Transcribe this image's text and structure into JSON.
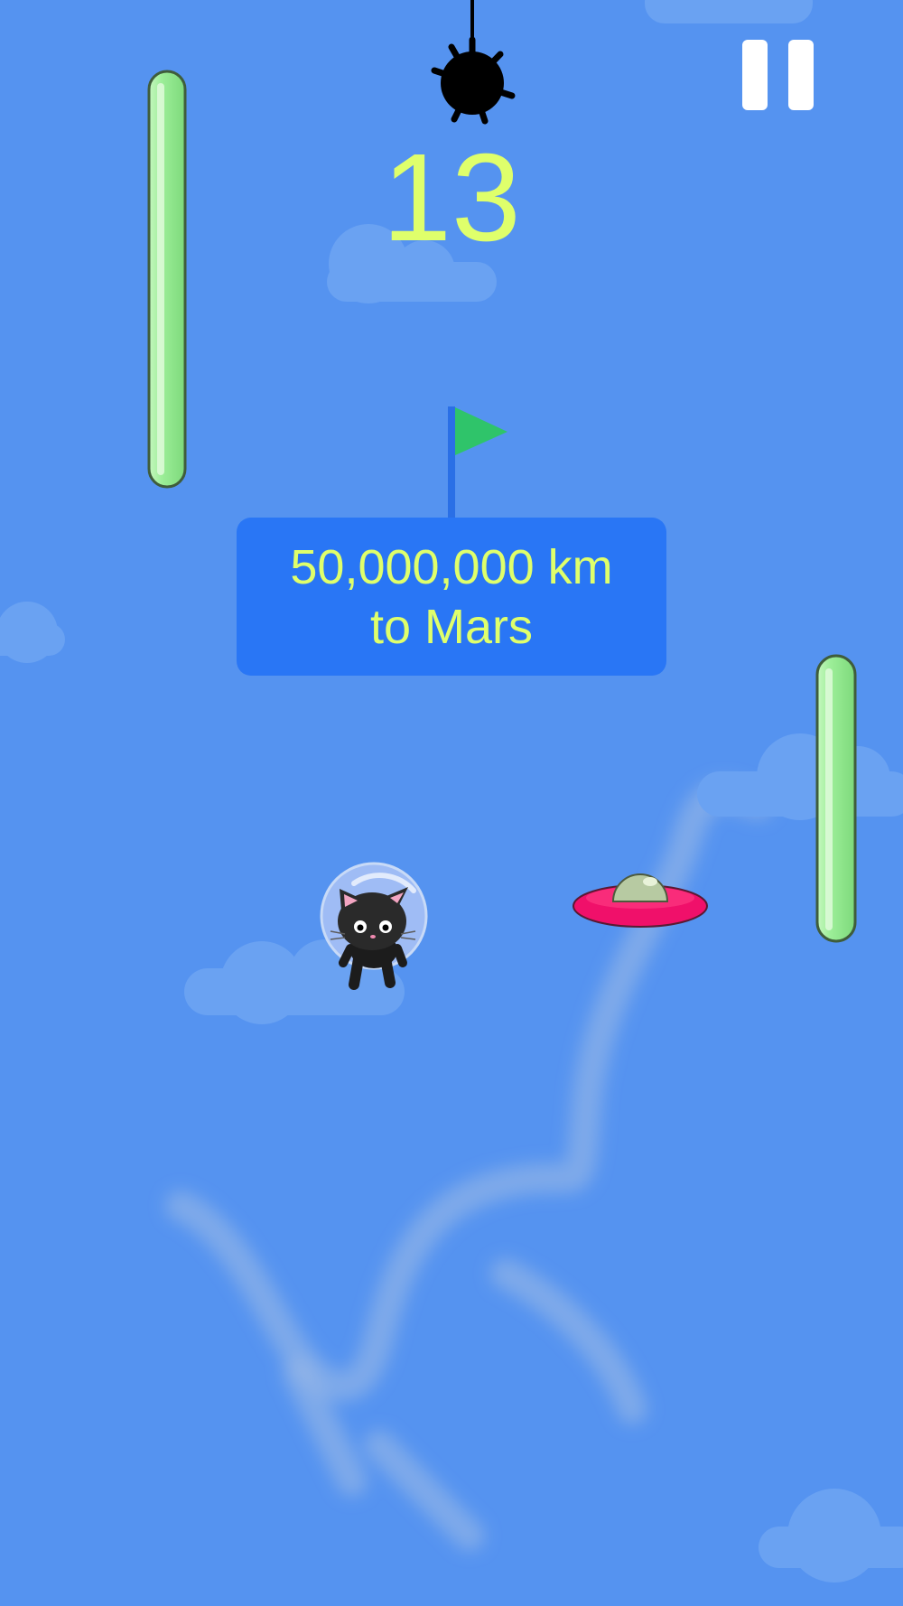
{
  "game": {
    "score": "13",
    "milestone": {
      "distance": "50,000,000 km",
      "destination": "to Mars"
    }
  },
  "colors": {
    "sky": "#5593f0",
    "cloud": "#6aa2f2",
    "score_text": "#dfff6b",
    "sign_bg": "#2976f5",
    "flag": "#2fc46a",
    "pillar": "#9cee98",
    "ufo_disc": "#f0106a",
    "ufo_dome": "#b7caa2",
    "mine": "#000000"
  },
  "icons": {
    "pause": "pause-icon",
    "flag": "flag-icon",
    "player": "astronaut-cat",
    "hazard": "spiked-mine",
    "enemy": "ufo"
  }
}
